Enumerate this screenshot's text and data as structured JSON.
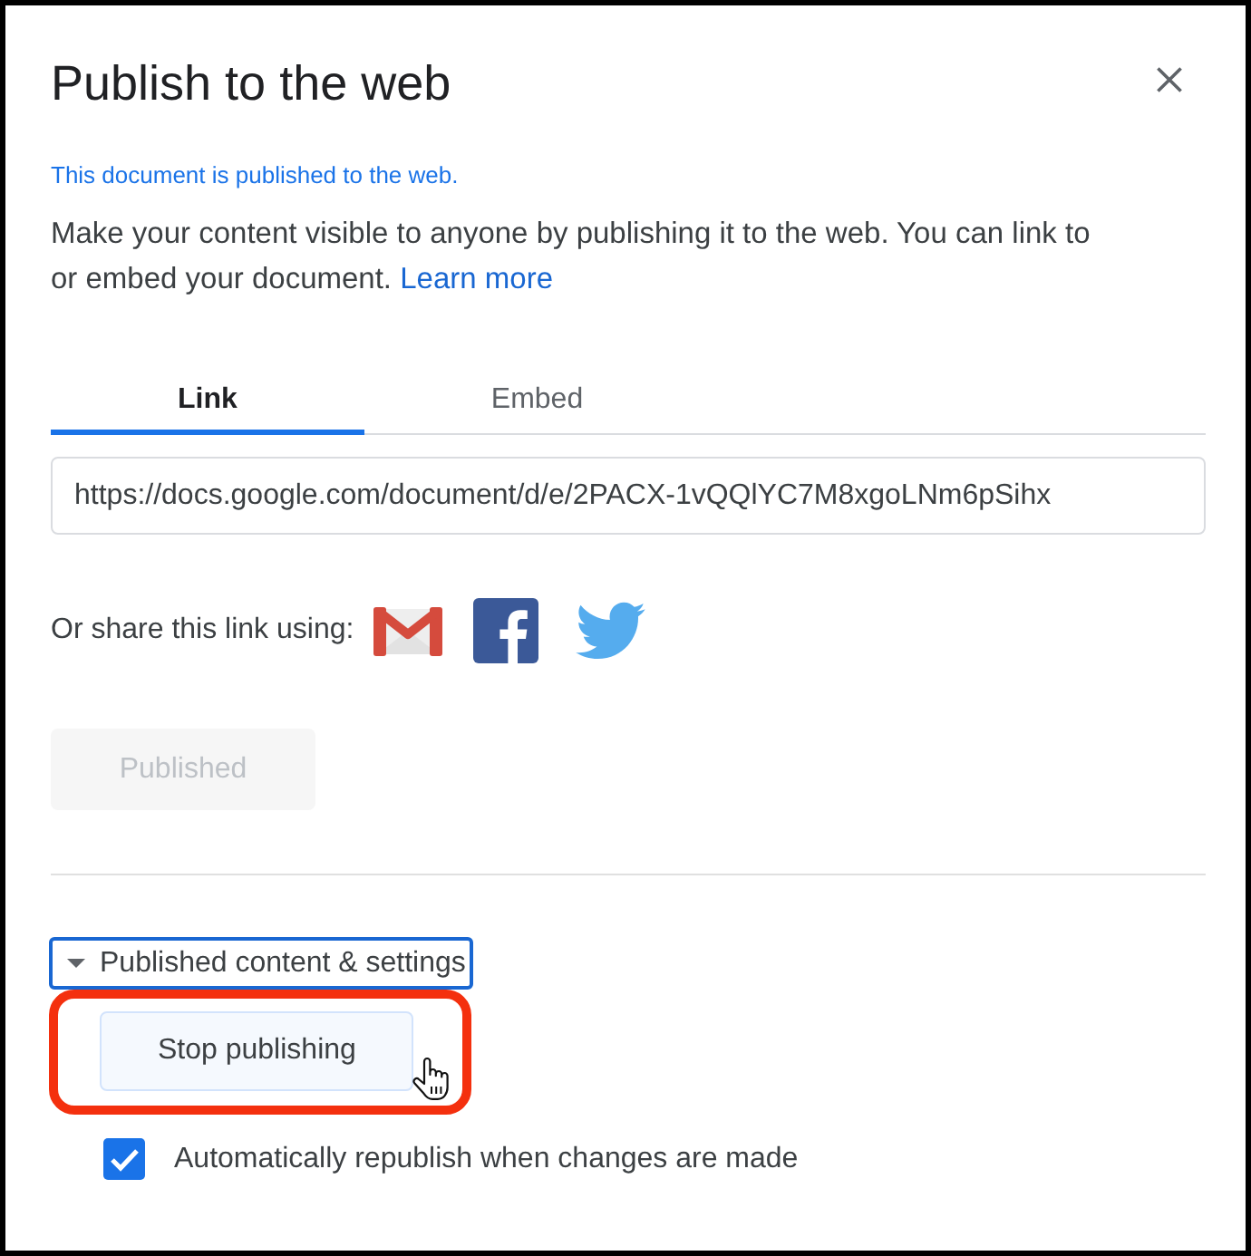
{
  "title": "Publish to the web",
  "status": "This document is published to the web.",
  "description": {
    "text": "Make your content visible to anyone by publishing it to the web. You can link to or embed your document.",
    "link": "Learn more"
  },
  "tabs": [
    {
      "label": "Link",
      "selected": true
    },
    {
      "label": "Embed",
      "selected": false
    }
  ],
  "link_field": {
    "value": "https://docs.google.com/document/d/e/2PACX-1vQQlYC7M8xgoLNm6pSihx"
  },
  "share": {
    "label": "Or share this link using:",
    "services": [
      {
        "kind": "gmail"
      },
      {
        "kind": "facebook"
      },
      {
        "kind": "twitter"
      }
    ]
  },
  "publish_button": {
    "label": "Published",
    "disabled": true
  },
  "settings": {
    "label": "Published content & settings",
    "expanded": true,
    "focused": true,
    "stop_button": {
      "label": "Stop publishing",
      "hovered": true,
      "highlighted": true
    },
    "auto_republish": {
      "label": "Automatically republish when changes are made",
      "checked": true
    }
  }
}
